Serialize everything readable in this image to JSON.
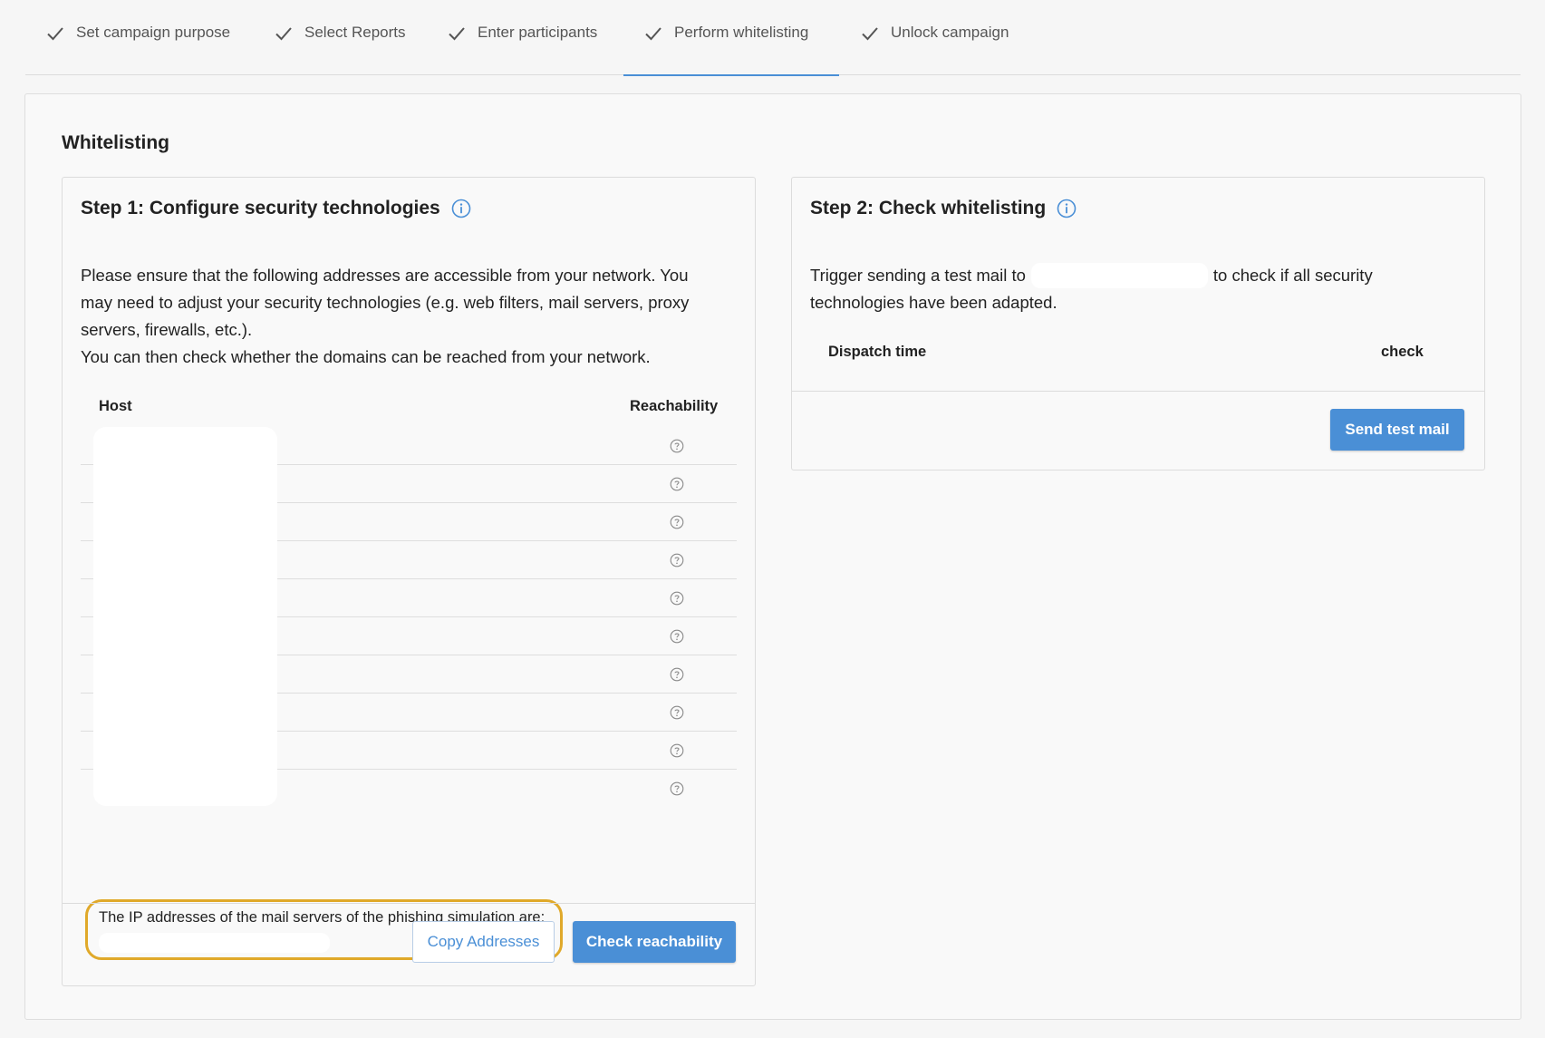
{
  "stepper": {
    "steps": [
      {
        "label": "Set campaign purpose"
      },
      {
        "label": "Select Reports"
      },
      {
        "label": "Enter participants"
      },
      {
        "label": "Perform whitelisting"
      },
      {
        "label": "Unlock campaign"
      }
    ],
    "active_index": 3
  },
  "main": {
    "title": "Whitelisting",
    "step1": {
      "title": "Step 1: Configure security technologies",
      "description_lines": [
        "Please ensure that the following addresses are accessible from your network. You",
        "may need to adjust your security technologies (e.g. web filters, mail servers, proxy",
        "servers, firewalls, etc.).",
        "You can then check whether the domains can be reached from your network."
      ],
      "table": {
        "headers": {
          "host": "Host",
          "reachability": "Reachability"
        },
        "row_count": 10,
        "reachability_icon": "question-circle-icon"
      },
      "ip_notice": "The IP addresses of the mail servers of the phishing simulation are:",
      "buttons": {
        "copy": "Copy Addresses",
        "check": "Check reachability"
      }
    },
    "step2": {
      "title": "Step 2: Check whitelisting",
      "description_part1": "Trigger sending a test mail to",
      "description_part2": "to check if all security",
      "description_line2": "technologies have been adapted.",
      "table": {
        "headers": {
          "dispatch_time": "Dispatch time",
          "check": "check"
        }
      },
      "button": "Send test mail"
    }
  },
  "colors": {
    "accent": "#4a8fd6",
    "highlight_border": "#e0a92a"
  }
}
